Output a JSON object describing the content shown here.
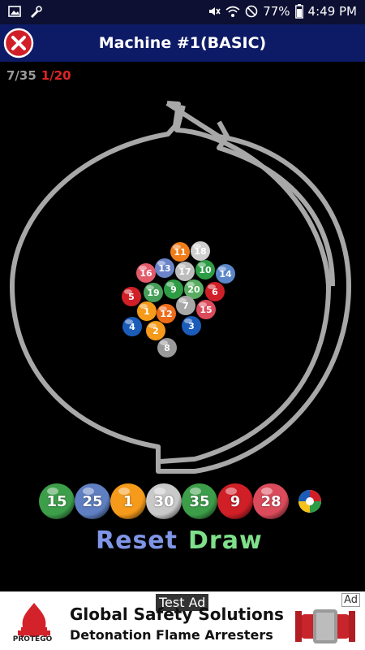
{
  "status_bar": {
    "battery_text": "77%",
    "time": "4:49 PM",
    "icons": [
      "image-icon",
      "settings-icon",
      "mute-icon",
      "wifi-icon",
      "no-disturb-icon",
      "battery-icon"
    ]
  },
  "header": {
    "title": "Machine #1(BASIC)",
    "close_icon": "close-icon"
  },
  "counters": {
    "progress": "7/35",
    "round": "1/20"
  },
  "machine": {
    "balls": [
      {
        "n": "11",
        "color": "#f07d1a"
      },
      {
        "n": "18",
        "color": "#cfcfcf"
      },
      {
        "n": "16",
        "color": "#e35a6a"
      },
      {
        "n": "13",
        "color": "#6b84c9"
      },
      {
        "n": "17",
        "color": "#bdbdbd"
      },
      {
        "n": "10",
        "color": "#2e9c45"
      },
      {
        "n": "14",
        "color": "#5b86c9"
      },
      {
        "n": "5",
        "color": "#d01f27"
      },
      {
        "n": "19",
        "color": "#47a05a"
      },
      {
        "n": "9",
        "color": "#2e9c45"
      },
      {
        "n": "20",
        "color": "#59ad62"
      },
      {
        "n": "6",
        "color": "#d01f27"
      },
      {
        "n": "1",
        "color": "#f59a1a"
      },
      {
        "n": "12",
        "color": "#ee6b1a"
      },
      {
        "n": "7",
        "color": "#a8a8a8"
      },
      {
        "n": "15",
        "color": "#dc4b5b"
      },
      {
        "n": "4",
        "color": "#1b5cb8"
      },
      {
        "n": "2",
        "color": "#f59a1a"
      },
      {
        "n": "3",
        "color": "#1b5cb8"
      },
      {
        "n": "8",
        "color": "#9a9a9a"
      }
    ]
  },
  "drawn": {
    "balls": [
      {
        "n": "15",
        "color": "#3d9e4a"
      },
      {
        "n": "25",
        "color": "#5f7fc2"
      },
      {
        "n": "1",
        "color": "#f59a1a"
      },
      {
        "n": "30",
        "color": "#c9c9c9"
      },
      {
        "n": "35",
        "color": "#3d9e4a"
      },
      {
        "n": "9",
        "color": "#d01f27"
      },
      {
        "n": "28",
        "color": "#dc4b5b"
      }
    ],
    "next_icon": "multicolor-ball-icon"
  },
  "actions": {
    "reset_label": "Reset",
    "draw_label": "Draw"
  },
  "ad": {
    "test_label": "Test Ad",
    "title": "Global Safety Solutions",
    "subtitle": "Detonation Flame Arresters",
    "brand": "PROTEGO",
    "choice_label": "Ad",
    "accent": "#d3222a"
  }
}
